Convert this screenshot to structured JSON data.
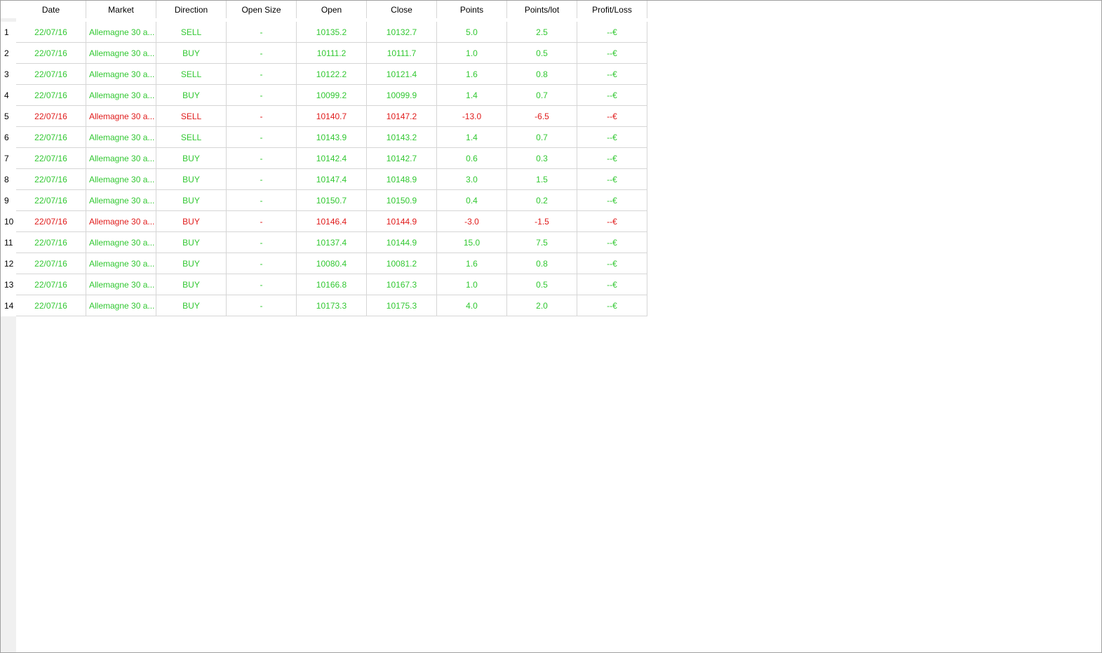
{
  "colors": {
    "win": "#32c832",
    "loss": "#e01b1b",
    "grid": "#d6d6d6",
    "gutter": "#f0f0f0"
  },
  "table": {
    "headers": [
      "Date",
      "Market",
      "Direction",
      "Open Size",
      "Open",
      "Close",
      "Points",
      "Points/lot",
      "Profit/Loss"
    ],
    "rows": [
      {
        "num": "1",
        "status": "win",
        "date": "22/07/16",
        "market": "Allemagne 30 a...",
        "direction": "SELL",
        "open_size": "-",
        "open": "10135.2",
        "close": "10132.7",
        "points": "5.0",
        "points_lot": "2.5",
        "pl": "--€"
      },
      {
        "num": "2",
        "status": "win",
        "date": "22/07/16",
        "market": "Allemagne 30 a...",
        "direction": "BUY",
        "open_size": "-",
        "open": "10111.2",
        "close": "10111.7",
        "points": "1.0",
        "points_lot": "0.5",
        "pl": "--€"
      },
      {
        "num": "3",
        "status": "win",
        "date": "22/07/16",
        "market": "Allemagne 30 a...",
        "direction": "SELL",
        "open_size": "-",
        "open": "10122.2",
        "close": "10121.4",
        "points": "1.6",
        "points_lot": "0.8",
        "pl": "--€"
      },
      {
        "num": "4",
        "status": "win",
        "date": "22/07/16",
        "market": "Allemagne 30 a...",
        "direction": "BUY",
        "open_size": "-",
        "open": "10099.2",
        "close": "10099.9",
        "points": "1.4",
        "points_lot": "0.7",
        "pl": "--€"
      },
      {
        "num": "5",
        "status": "loss",
        "date": "22/07/16",
        "market": "Allemagne 30 a...",
        "direction": "SELL",
        "open_size": "-",
        "open": "10140.7",
        "close": "10147.2",
        "points": "-13.0",
        "points_lot": "-6.5",
        "pl": "--€"
      },
      {
        "num": "6",
        "status": "win",
        "date": "22/07/16",
        "market": "Allemagne 30 a...",
        "direction": "SELL",
        "open_size": "-",
        "open": "10143.9",
        "close": "10143.2",
        "points": "1.4",
        "points_lot": "0.7",
        "pl": "--€"
      },
      {
        "num": "7",
        "status": "win",
        "date": "22/07/16",
        "market": "Allemagne 30 a...",
        "direction": "BUY",
        "open_size": "-",
        "open": "10142.4",
        "close": "10142.7",
        "points": "0.6",
        "points_lot": "0.3",
        "pl": "--€"
      },
      {
        "num": "8",
        "status": "win",
        "date": "22/07/16",
        "market": "Allemagne 30 a...",
        "direction": "BUY",
        "open_size": "-",
        "open": "10147.4",
        "close": "10148.9",
        "points": "3.0",
        "points_lot": "1.5",
        "pl": "--€"
      },
      {
        "num": "9",
        "status": "win",
        "date": "22/07/16",
        "market": "Allemagne 30 a...",
        "direction": "BUY",
        "open_size": "-",
        "open": "10150.7",
        "close": "10150.9",
        "points": "0.4",
        "points_lot": "0.2",
        "pl": "--€"
      },
      {
        "num": "10",
        "status": "loss",
        "date": "22/07/16",
        "market": "Allemagne 30 a...",
        "direction": "BUY",
        "open_size": "-",
        "open": "10146.4",
        "close": "10144.9",
        "points": "-3.0",
        "points_lot": "-1.5",
        "pl": "--€"
      },
      {
        "num": "11",
        "status": "win",
        "date": "22/07/16",
        "market": "Allemagne 30 a...",
        "direction": "BUY",
        "open_size": "-",
        "open": "10137.4",
        "close": "10144.9",
        "points": "15.0",
        "points_lot": "7.5",
        "pl": "--€"
      },
      {
        "num": "12",
        "status": "win",
        "date": "22/07/16",
        "market": "Allemagne 30 a...",
        "direction": "BUY",
        "open_size": "-",
        "open": "10080.4",
        "close": "10081.2",
        "points": "1.6",
        "points_lot": "0.8",
        "pl": "--€"
      },
      {
        "num": "13",
        "status": "win",
        "date": "22/07/16",
        "market": "Allemagne 30 a...",
        "direction": "BUY",
        "open_size": "-",
        "open": "10166.8",
        "close": "10167.3",
        "points": "1.0",
        "points_lot": "0.5",
        "pl": "--€"
      },
      {
        "num": "14",
        "status": "win",
        "date": "22/07/16",
        "market": "Allemagne 30 a...",
        "direction": "BUY",
        "open_size": "-",
        "open": "10173.3",
        "close": "10175.3",
        "points": "4.0",
        "points_lot": "2.0",
        "pl": "--€"
      }
    ]
  }
}
